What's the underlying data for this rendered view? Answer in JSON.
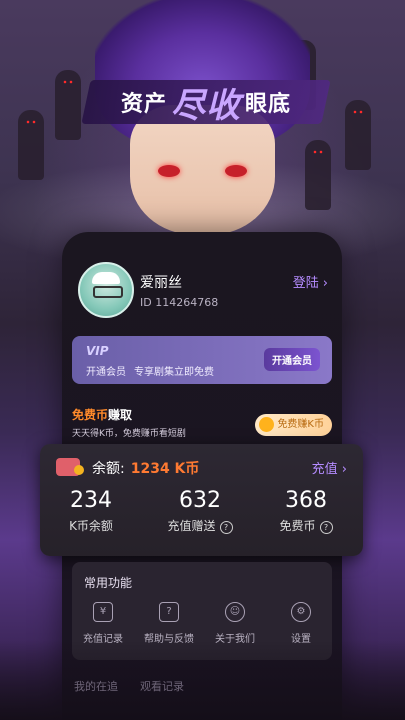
{
  "banner": {
    "part1": "资产",
    "part2": "尽收",
    "part3": "眼底"
  },
  "profile": {
    "name": "爱丽丝",
    "id_text": "ID 114264768",
    "login_label": "登陆",
    "chevron": "›"
  },
  "vip": {
    "logo": "VIP",
    "desc1": "开通会员",
    "desc2": "专享剧集立即免费",
    "button": "开通会员"
  },
  "free_coin": {
    "title_highlight": "免费币",
    "title_rest": "赚取",
    "desc": "天天得K币，免费赚币看短剧",
    "button": "免费赚K币"
  },
  "balance": {
    "label": "余额:",
    "value": "1234 K币",
    "recharge": "充值",
    "chevron": "›",
    "stats": [
      {
        "num": "234",
        "label": "K币余额"
      },
      {
        "num": "632",
        "label": "充值赠送"
      },
      {
        "num": "368",
        "label": "免费币"
      }
    ],
    "help_mark": "?"
  },
  "functions": {
    "title": "常用功能",
    "items": [
      {
        "label": "充值记录",
        "icon": "receipt-icon",
        "glyph": "¥"
      },
      {
        "label": "帮助与反馈",
        "icon": "help-icon",
        "glyph": "?"
      },
      {
        "label": "关于我们",
        "icon": "user-icon",
        "glyph": "☺"
      },
      {
        "label": "设置",
        "icon": "gear-icon",
        "glyph": "⚙"
      }
    ]
  },
  "tabs": [
    "我的在追",
    "观看记录"
  ]
}
